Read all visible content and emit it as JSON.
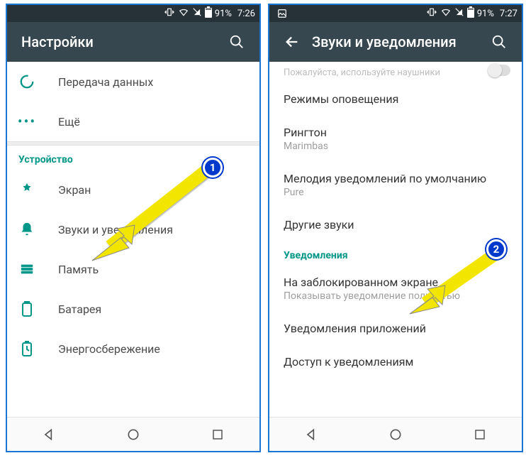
{
  "left": {
    "status": {
      "battery": "91%",
      "time": "7:26"
    },
    "appbar": {
      "title": "Настройки"
    },
    "rows": {
      "data_usage": "Передача данных",
      "more": "Ещё"
    },
    "section_device": "Устройство",
    "device_rows": {
      "display": "Экран",
      "sound": "Звуки и уведомления",
      "memory": "Память",
      "battery": "Батарея",
      "power": "Энергосбережение"
    },
    "marker": "1"
  },
  "right": {
    "status": {
      "battery": "91%",
      "time": "7:27"
    },
    "appbar": {
      "title": "Звуки и уведомления"
    },
    "hint": "Пожалуйста, используйте наушники",
    "rows": {
      "alert_modes": "Режимы оповещения",
      "ringtone": {
        "title": "Рингтон",
        "value": "Marimbas"
      },
      "notif_sound": {
        "title": "Мелодия уведомлений по умолчанию",
        "value": "Pure"
      },
      "other_sounds": "Другие звуки"
    },
    "section_notif": "Уведомления",
    "notif_rows": {
      "lock": {
        "title": "На заблокированном экране",
        "value": "Показывать уведомление полностью"
      },
      "apps": "Уведомления приложений",
      "access": "Доступ к уведомлениям"
    },
    "marker": "2"
  }
}
